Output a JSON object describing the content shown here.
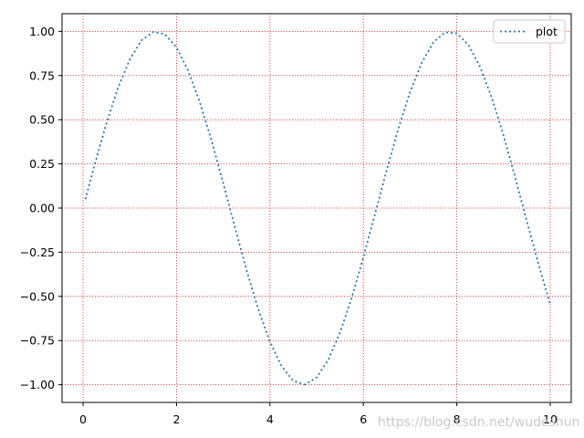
{
  "chart_data": {
    "type": "line",
    "title": "",
    "xlabel": "",
    "ylabel": "",
    "xlim": [
      -0.45,
      10.45
    ],
    "ylim": [
      -1.1,
      1.1
    ],
    "xticks": [
      0,
      2,
      4,
      6,
      8,
      10
    ],
    "xtick_labels": [
      "0",
      "2",
      "4",
      "6",
      "8",
      "10"
    ],
    "yticks": [
      -1.0,
      -0.75,
      -0.5,
      -0.25,
      0.0,
      0.25,
      0.5,
      0.75,
      1.0
    ],
    "ytick_labels": [
      "−1.00",
      "−0.75",
      "−0.50",
      "−0.25",
      "0.00",
      "0.25",
      "0.50",
      "0.75",
      "1.00"
    ],
    "grid": true,
    "grid_color": "#ff0000",
    "grid_style": "dotted",
    "legend_position": "top-right",
    "series": [
      {
        "name": "plot",
        "color": "#1f77b4",
        "line_style": "dotted",
        "x": [
          0.05,
          0.25,
          0.5,
          0.75,
          1.0,
          1.25,
          1.5,
          1.75,
          2.0,
          2.25,
          2.5,
          2.75,
          3.0,
          3.25,
          3.5,
          3.75,
          4.0,
          4.25,
          4.5,
          4.75,
          5.0,
          5.25,
          5.5,
          5.75,
          6.0,
          6.25,
          6.5,
          6.75,
          7.0,
          7.25,
          7.5,
          7.75,
          8.0,
          8.25,
          8.5,
          8.75,
          9.0,
          9.25,
          9.5,
          9.75,
          10.0
        ],
        "y": [
          0.05,
          0.247,
          0.479,
          0.682,
          0.841,
          0.949,
          0.997,
          0.984,
          0.909,
          0.778,
          0.598,
          0.382,
          0.141,
          -0.108,
          -0.351,
          -0.572,
          -0.757,
          -0.895,
          -0.978,
          -0.999,
          -0.959,
          -0.859,
          -0.706,
          -0.508,
          -0.279,
          -0.033,
          0.215,
          0.45,
          0.657,
          0.823,
          0.938,
          0.995,
          0.989,
          0.923,
          0.798,
          0.624,
          0.412,
          0.174,
          -0.075,
          -0.319,
          -0.544
        ]
      }
    ]
  },
  "watermark": "https://blog.csdn.net/wudeshun"
}
